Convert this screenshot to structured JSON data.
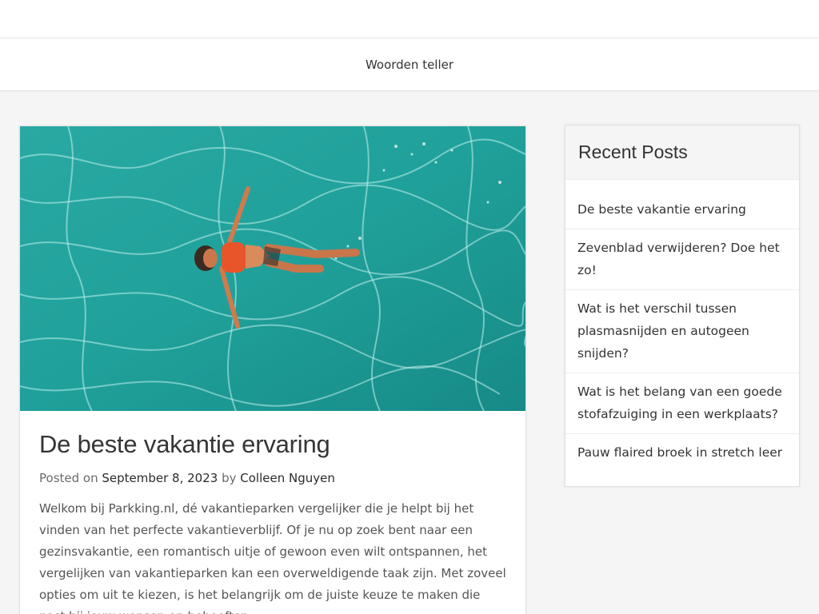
{
  "nav": {
    "menu_item": "Woorden teller"
  },
  "post": {
    "title": "De beste vakantie ervaring",
    "posted_on_label": "Posted on",
    "date": "September 8, 2023",
    "by_label": "by",
    "author": "Colleen Nguyen",
    "excerpt": "Welkom bij Parkking.nl, dé vakantieparken vergelijker die je helpt bij het vinden van het perfecte vakantieverblijf. Of je nu op zoek bent naar een gezinsvakantie, een romantisch uitje of gewoon even wilt ontspannen, het vergelijken van vakantieparken kan een overweldigende taak zijn. Met zoveel opties om uit te kiezen, is het belangrijk om de juiste keuze te maken die past bij jouw wensen en behoeften."
  },
  "sidebar": {
    "widget_title": "Recent Posts",
    "items": [
      {
        "label": "De beste vakantie ervaring"
      },
      {
        "label": "Zevenblad verwijderen? Doe het zo!"
      },
      {
        "label": "Wat is het verschil tussen plasmasnijden en autogeen snijden?"
      },
      {
        "label": "Wat is het belang van een goede stofafzuiging in een werkplaats?"
      },
      {
        "label": "Pauw flaired broek in stretch leer"
      }
    ]
  },
  "colors": {
    "water": "#1d9b95",
    "swimsuit": "#e8552b"
  }
}
